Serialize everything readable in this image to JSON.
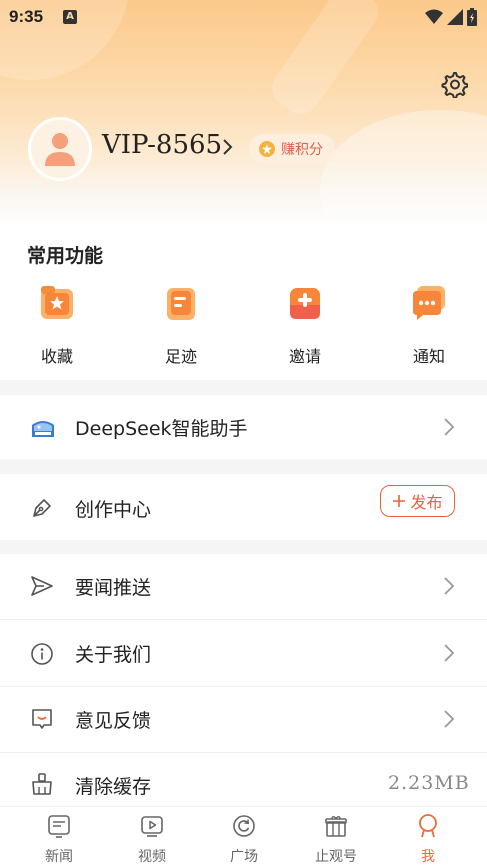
{
  "status_bar": {
    "time": "9:35",
    "notification_icon": "A"
  },
  "profile": {
    "username": "VIP-8565",
    "points_button": "赚积分"
  },
  "functions": {
    "title": "常用功能",
    "items": [
      {
        "label": "收藏",
        "icon": "favorite-star-icon"
      },
      {
        "label": "足迹",
        "icon": "footprint-icon"
      },
      {
        "label": "邀请",
        "icon": "invite-plus-icon"
      },
      {
        "label": "通知",
        "icon": "notification-chat-icon"
      }
    ]
  },
  "menu": {
    "deepseek": "DeepSeek智能助手",
    "creation": "创作中心",
    "publish": "发布",
    "news_push": "要闻推送",
    "about": "关于我们",
    "feedback": "意见反馈",
    "clear_cache": "清除缓存",
    "cache_size": "2.23MB"
  },
  "tabs": [
    {
      "label": "新闻",
      "icon": "news-icon"
    },
    {
      "label": "视频",
      "icon": "video-icon"
    },
    {
      "label": "广场",
      "icon": "square-refresh-icon"
    },
    {
      "label": "止观号",
      "icon": "gift-icon"
    },
    {
      "label": "我",
      "icon": "profile-icon"
    }
  ],
  "colors": {
    "accent": "#f06a3c",
    "header_top": "#fcc98a",
    "publish": "#e8623e"
  }
}
